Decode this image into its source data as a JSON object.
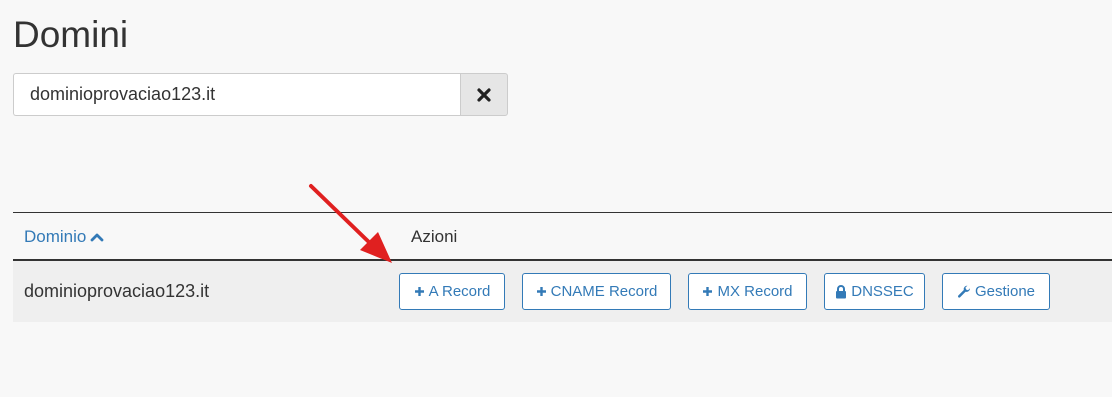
{
  "page": {
    "title": "Domini"
  },
  "search": {
    "value": "dominioprovaciao123.it",
    "clear_icon": "times-icon"
  },
  "table": {
    "columns": {
      "domain": "Dominio",
      "domain_sort_icon": "chevron-up-icon",
      "actions": "Azioni"
    },
    "rows": [
      {
        "domain": "dominioprovaciao123.it",
        "actions": [
          {
            "label": "A Record",
            "icon": "plus-icon"
          },
          {
            "label": "CNAME Record",
            "icon": "plus-icon"
          },
          {
            "label": "MX Record",
            "icon": "plus-icon"
          },
          {
            "label": "DNSSEC",
            "icon": "lock-icon"
          },
          {
            "label": "Gestione",
            "icon": "wrench-icon"
          }
        ]
      }
    ]
  },
  "annotation": {
    "icon": "red-arrow-icon",
    "color": "#e02020"
  },
  "colors": {
    "link": "#337ab7",
    "background": "#f8f8f8",
    "row_background": "#efefef"
  }
}
